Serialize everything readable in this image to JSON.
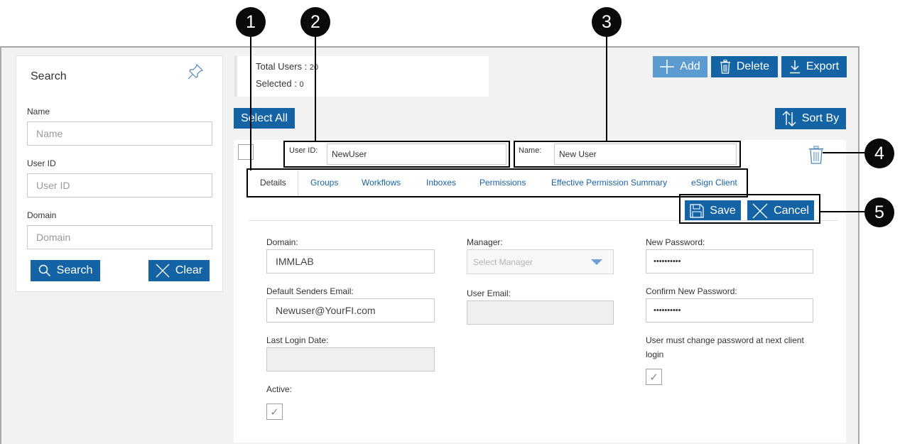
{
  "search_panel": {
    "title": "Search",
    "name_label": "Name",
    "name_placeholder": "Name",
    "userid_label": "User ID",
    "userid_placeholder": "User ID",
    "domain_label": "Domain",
    "domain_placeholder": "Domain",
    "search_button": "Search",
    "clear_button": "Clear"
  },
  "summary": {
    "total_label": "Total Users : ",
    "total_value": "20",
    "selected_label": "Selected : ",
    "selected_value": "0"
  },
  "toolbar": {
    "add": "Add",
    "delete": "Delete",
    "export": "Export",
    "select_all": "Select All",
    "sort_by": "Sort By"
  },
  "user_row": {
    "userid_label": "User ID:",
    "userid_value": "NewUser",
    "name_label": "Name:",
    "name_value": "New User"
  },
  "tabs": [
    "Details",
    "Groups",
    "Workflows",
    "Inboxes",
    "Permissions",
    "Effective Permission Summary",
    "eSign Client"
  ],
  "actions": {
    "save": "Save",
    "cancel": "Cancel"
  },
  "details": {
    "domain_label": "Domain:",
    "domain_value": "IMMLAB",
    "default_email_label": "Default Senders Email:",
    "default_email_value": "Newuser@YourFI.com",
    "last_login_label": "Last Login Date:",
    "last_login_value": "",
    "active_label": "Active:",
    "active_checked": true,
    "manager_label": "Manager:",
    "manager_placeholder": "Select Manager",
    "user_email_label": "User Email:",
    "user_email_value": "",
    "new_password_label": "New Password:",
    "new_password_value": "••••••••••",
    "confirm_password_label": "Confirm New Password:",
    "confirm_password_value": "••••••••••",
    "must_change_label": "User must change password at next client login",
    "must_change_checked": true
  },
  "callouts": [
    "1",
    "2",
    "3",
    "4",
    "5"
  ],
  "colors": {
    "primary": "#1464a5",
    "add_button": "#5b9bd0",
    "tab_text": "#1a62a6",
    "callout": "#0a0a0a"
  }
}
